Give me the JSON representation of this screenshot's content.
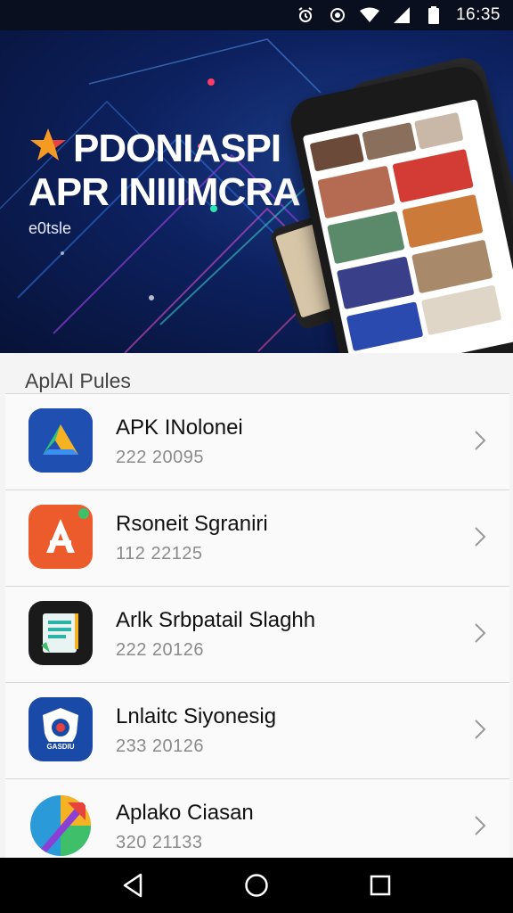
{
  "status_bar": {
    "time": "16:35",
    "icons": [
      "alarm-icon",
      "eye-icon",
      "wifi-icon",
      "signal-icon",
      "battery-icon"
    ]
  },
  "banner": {
    "title_line1": "PDONIASPI",
    "title_line2": "APR INIIIMCRA",
    "subtitle": "e0tsle",
    "logo_icon": "star-icon"
  },
  "section": {
    "header": "AplAI Pules"
  },
  "apps": [
    {
      "name": "APK INolonei",
      "meta": "222 20095",
      "icon": "arrow-a-icon"
    },
    {
      "name": "Rsoneit Sgraniri",
      "meta": "112 22125",
      "icon": "letter-a-icon"
    },
    {
      "name": "Arlk Srbpatail Slaghh",
      "meta": "222 20126",
      "icon": "document-icon"
    },
    {
      "name": "Lnlaitc Siyonesig",
      "meta": "233 20126",
      "icon": "shield-icon"
    },
    {
      "name": "Aplako Ciasan",
      "meta": "320 21133",
      "icon": "colorful-arrow-icon"
    }
  ],
  "nav": {
    "back": "back-icon",
    "home": "home-icon",
    "recents": "recents-icon"
  },
  "colors": {
    "banner_bg": "#0d2160",
    "list_bg": "#fafafa",
    "nav_bg": "#000000"
  }
}
